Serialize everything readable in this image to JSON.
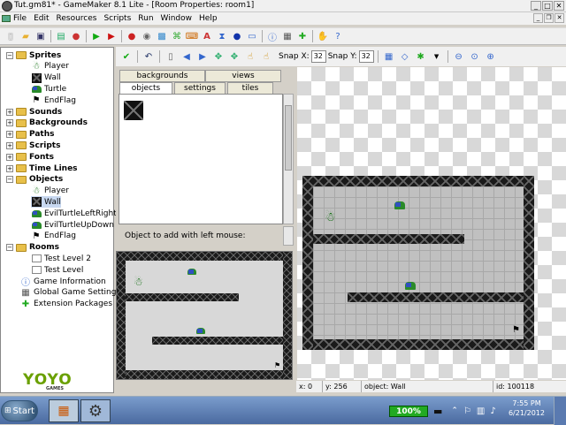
{
  "window": {
    "title": "Tut.gm81* - GameMaker 8.1 Lite - [Room Properties: room1]"
  },
  "menu": [
    "File",
    "Edit",
    "Resources",
    "Scripts",
    "Run",
    "Window",
    "Help"
  ],
  "tree": [
    {
      "label": "Sprites",
      "bold": true,
      "level": 0,
      "type": "folder",
      "open": true
    },
    {
      "label": "Player",
      "level": 1,
      "type": "player"
    },
    {
      "label": "Wall",
      "level": 1,
      "type": "wall"
    },
    {
      "label": "Turtle",
      "level": 1,
      "type": "turtle"
    },
    {
      "label": "EndFlag",
      "level": 1,
      "type": "flag"
    },
    {
      "label": "Sounds",
      "bold": true,
      "level": 0,
      "type": "folder"
    },
    {
      "label": "Backgrounds",
      "bold": true,
      "level": 0,
      "type": "folder"
    },
    {
      "label": "Paths",
      "bold": true,
      "level": 0,
      "type": "folder"
    },
    {
      "label": "Scripts",
      "bold": true,
      "level": 0,
      "type": "folder"
    },
    {
      "label": "Fonts",
      "bold": true,
      "level": 0,
      "type": "folder"
    },
    {
      "label": "Time Lines",
      "bold": true,
      "level": 0,
      "type": "folder"
    },
    {
      "label": "Objects",
      "bold": true,
      "level": 0,
      "type": "folder",
      "open": true
    },
    {
      "label": "Player",
      "level": 1,
      "type": "player"
    },
    {
      "label": "Wall",
      "level": 1,
      "type": "wall",
      "selected": true
    },
    {
      "label": "EvilTurtleLeftRight",
      "level": 1,
      "type": "turtle"
    },
    {
      "label": "EvilTurtleUpDown",
      "level": 1,
      "type": "turtle"
    },
    {
      "label": "EndFlag",
      "level": 1,
      "type": "flag"
    },
    {
      "label": "Rooms",
      "bold": true,
      "level": 0,
      "type": "folder",
      "open": true
    },
    {
      "label": "Test Level 2",
      "level": 1,
      "type": "room"
    },
    {
      "label": "Test Level",
      "level": 1,
      "type": "room"
    },
    {
      "label": "Game Information",
      "level": 0,
      "type": "info"
    },
    {
      "label": "Global Game Settings",
      "level": 0,
      "type": "settings"
    },
    {
      "label": "Extension Packages",
      "level": 0,
      "type": "ext"
    }
  ],
  "logo": {
    "text": "YOYO",
    "sub": "GAMES"
  },
  "room_toolbar": {
    "snap_x_label": "Snap X:",
    "snap_x": "32",
    "snap_y_label": "Snap Y:",
    "snap_y": "32"
  },
  "tabs": {
    "backgrounds": "backgrounds",
    "views": "views",
    "objects": "objects",
    "settings": "settings",
    "tiles": "tiles"
  },
  "object_label": "Object to add with left mouse:",
  "status": {
    "x": "x: 0",
    "y": "y: 256",
    "object": "object: Wall",
    "id": "id: 100118"
  },
  "taskbar": {
    "start": "Start",
    "battery": "100%",
    "time": "7:55 PM",
    "date": "6/21/2012"
  }
}
